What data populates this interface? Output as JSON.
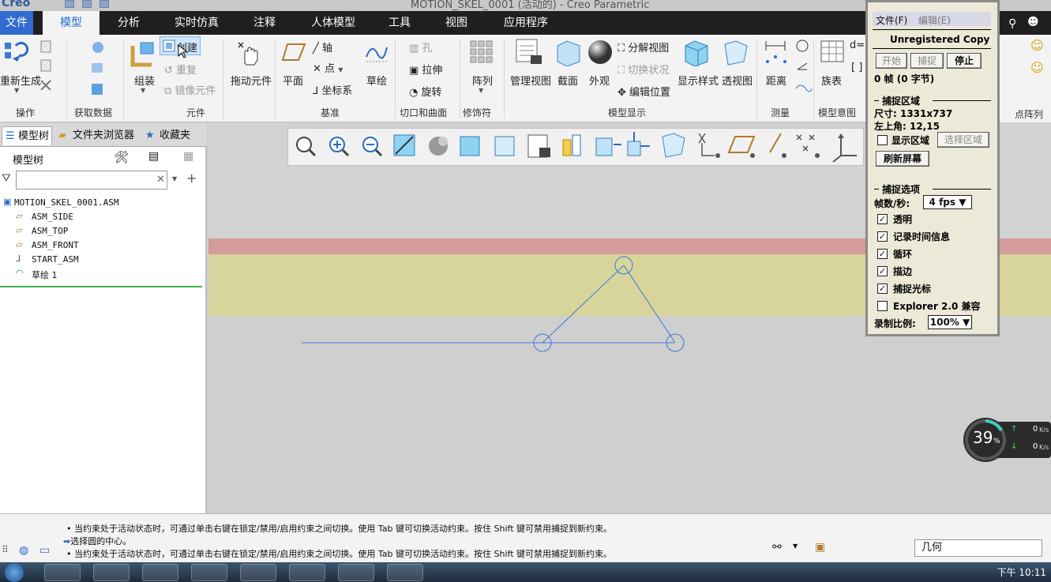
{
  "titlebar": {
    "app_name": "Creo",
    "doc_title": "MOTION_SKEL_0001 (活动的) - Creo Parametric"
  },
  "tabs": [
    "文件",
    "模型",
    "分析",
    "实时仿真",
    "注释",
    "人体模型",
    "工具",
    "视图",
    "应用程序"
  ],
  "ribbon": {
    "regen": "重新生成",
    "create": "创建",
    "repeat": "重复",
    "mirror": "镜像元件",
    "assemble": "组装",
    "drag": "拖动元件",
    "plane": "平面",
    "axis": "轴",
    "point": "点",
    "csys": "坐标系",
    "sketch": "草绘",
    "hole": "孔",
    "extrude": "拉伸",
    "revolve": "旋转",
    "pattern": "阵列",
    "manage_views": "管理视图",
    "section": "截面",
    "appearance": "外观",
    "explode": "分解视图",
    "toggle_state": "切换状况",
    "edit_pos": "编辑位置",
    "display_style": "显示样式",
    "perspective": "透视图",
    "distance": "距离",
    "family_table": "族表",
    "groups": [
      "操作",
      "获取数据",
      "元件",
      "基准",
      "切口和曲面",
      "修饰符",
      "模型显示",
      "测量",
      "模型意图"
    ],
    "right_group": "点阵列关"
  },
  "nav": {
    "tabs": [
      "模型树",
      "文件夹浏览器",
      "收藏夹"
    ],
    "tree_title": "模型树",
    "filter_placeholder": "",
    "nodes": [
      "MOTION_SKEL_0001.ASM",
      "ASM_SIDE",
      "ASM_TOP",
      "ASM_FRONT",
      "START_ASM",
      "草绘 1"
    ]
  },
  "status": {
    "messages": [
      "当约束处于活动状态时，可通过单击右键在锁定/禁用/启用约束之间切换。使用 Tab 键可切换活动约束。按住 Shift 键可禁用捕捉到新约束。",
      "选择圆的中心。",
      "当约束处于活动状态时，可通过单击右键在锁定/禁用/启用约束之间切换。使用 Tab 键可切换活动约束。按住 Shift 键可禁用捕捉到新约束。"
    ],
    "filter_value": "几何"
  },
  "net_widget": {
    "percent": "39",
    "pct_sign": "%",
    "up": "0",
    "down": "0",
    "unit": "K/s"
  },
  "taskbar": {
    "time_prefix": "下午",
    "time": "10:11"
  },
  "capture_dialog": {
    "menu_file": "文件(F)",
    "menu_edit": "编辑(E)",
    "banner": "Unregistered Copy",
    "btn_start": "开始",
    "btn_capture": "捕捉",
    "btn_stop": "停止",
    "frames": "0 帧 (0 字节)",
    "section_region": "捕捉区域",
    "size": "尺寸: 1331x737",
    "top_left": "左上角: 12,15",
    "show_region": "显示区域",
    "select_region": "选择区域",
    "refresh": "刷新屏幕",
    "section_options": "捕捉选项",
    "fps_label": "帧数/秒:",
    "fps_value": "4 fps",
    "opt_transparent": "透明",
    "opt_timeinfo": "记录时间信息",
    "opt_loop": "循环",
    "opt_outline": "描边",
    "opt_cursor": "捕捉光标",
    "opt_explorer": "Explorer 2.0 兼容",
    "scale_label": "录制比例:",
    "scale_value": "100%",
    "check_mark": "✓"
  },
  "colors": {
    "accent": "#1f6fd1",
    "file_tab": "#2f6bd0",
    "sketch_line": "#3a78d6",
    "band_red": "#d49b9b",
    "band_yellow": "#d7d59b"
  }
}
